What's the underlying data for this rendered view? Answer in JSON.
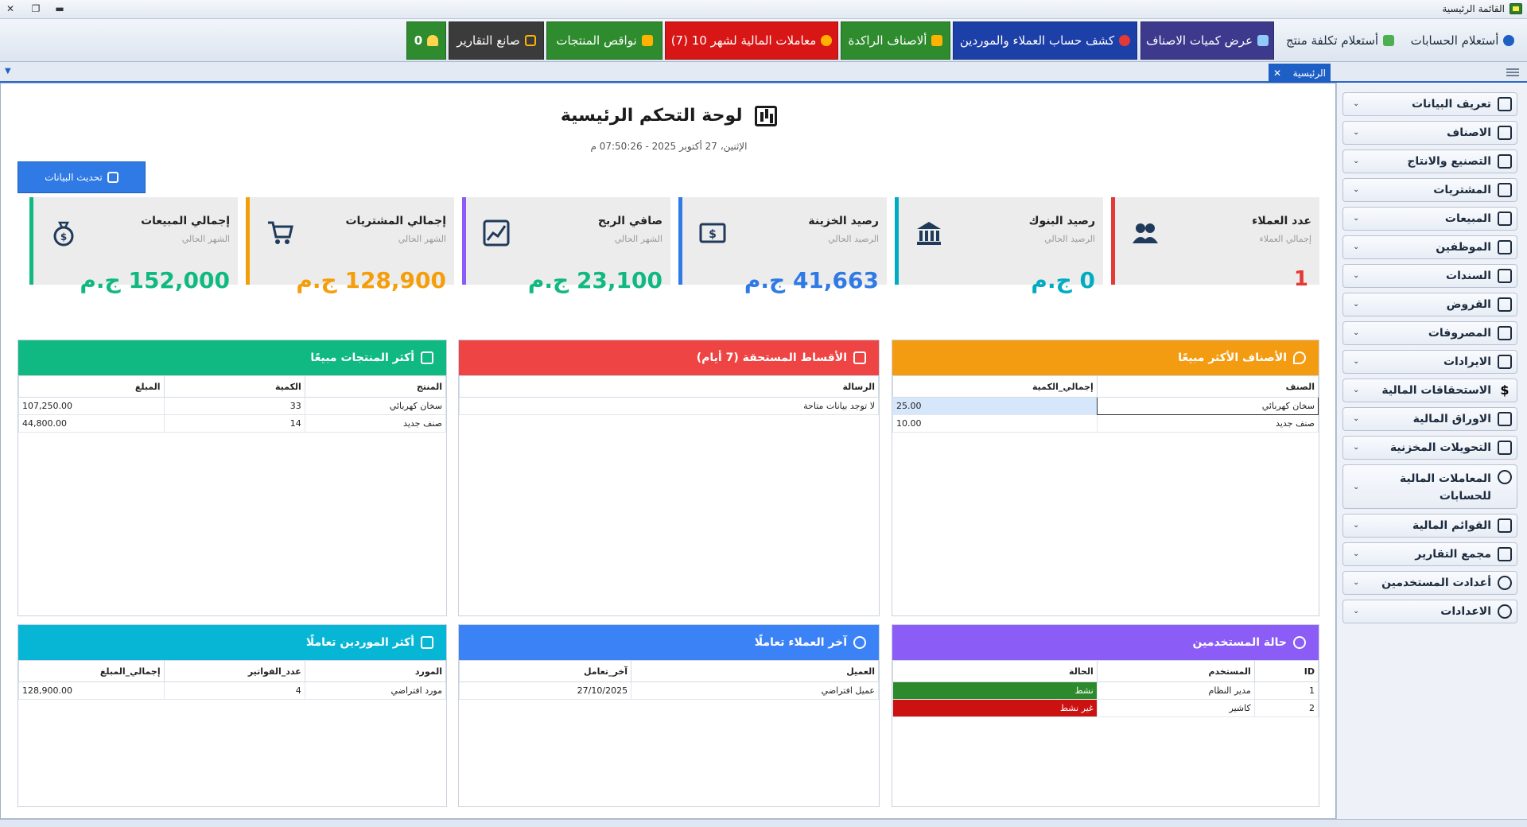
{
  "window": {
    "title": "القائمة الرئيسية"
  },
  "toolbar": {
    "buttons": [
      {
        "label": "أستعلام الحسابات"
      },
      {
        "label": "أستعلام تكلفة منتج"
      },
      {
        "label": "عرض كميات الاصناف"
      },
      {
        "label": "كشف حساب العملاء والموردين"
      },
      {
        "label": "ألاصناف الراكدة"
      },
      {
        "label": "معاملات المالية لشهر 10  (7)"
      },
      {
        "label": "نواقص المنتجات"
      },
      {
        "label": "صانع التقارير"
      },
      {
        "label": "0"
      }
    ]
  },
  "tabs": {
    "home": "الرئيسية",
    "close": "✕"
  },
  "sidebar": {
    "items": [
      {
        "label": "تعريف البيانات",
        "icon": "database-icon"
      },
      {
        "label": "الاصناف",
        "icon": "box-icon"
      },
      {
        "label": "التصنيع والانتاج",
        "icon": "factory-icon"
      },
      {
        "label": "المشتريات",
        "icon": "cart-icon"
      },
      {
        "label": "المبيعات",
        "icon": "invoice-icon"
      },
      {
        "label": "الموظفين",
        "icon": "badge-icon"
      },
      {
        "label": "السندات",
        "icon": "receipt-icon"
      },
      {
        "label": "القروض",
        "icon": "loan-icon"
      },
      {
        "label": "المصروفات",
        "icon": "expense-icon"
      },
      {
        "label": "الايرادات",
        "icon": "income-icon"
      },
      {
        "label": "الاستحقاقات المالية",
        "icon": "dollar-icon"
      },
      {
        "label": "الاوراق المالية",
        "icon": "securities-icon"
      },
      {
        "label": "التحويلات المخزنية",
        "icon": "transfer-icon"
      },
      {
        "label": "المعاملات المالية للحسابات",
        "icon": "gear-icon"
      },
      {
        "label": "القوائم المالية",
        "icon": "briefcase-icon"
      },
      {
        "label": "مجمع التقارير",
        "icon": "report-icon"
      },
      {
        "label": "أعدادت المستخدمين",
        "icon": "users-icon"
      },
      {
        "label": "الاعدادات",
        "icon": "settings-icon"
      }
    ]
  },
  "dashboard": {
    "title": "لوحة التحكم الرئيسية",
    "datetime": "الإثنين، 27 أكتوبر 2025 - 07:50:26 م",
    "refresh_label": "تحديث البيانات"
  },
  "cards": [
    {
      "title": "عدد العملاء",
      "sub": "إجمالي العملاء",
      "value": "1",
      "color": "#e53935"
    },
    {
      "title": "رصيد البنوك",
      "sub": "الرصيد الحالي",
      "value": "0 ج.م",
      "color": "#00acc1"
    },
    {
      "title": "رصيد الخزينة",
      "sub": "الرصيد الحالي",
      "value": "41,663 ج.م",
      "color": "#2f7ae5"
    },
    {
      "title": "صافي الربح",
      "sub": "الشهر الحالي",
      "value": "23,100 ج.م",
      "color": "#10b981"
    },
    {
      "title": "إجمالي المشتريات",
      "sub": "الشهر الحالي",
      "value": "128,900 ج.م",
      "color": "#f59e0b"
    },
    {
      "title": "إجمالي المبيعات",
      "sub": "الشهر الحالي",
      "value": "152,000 ج.م",
      "color": "#10b981"
    }
  ],
  "panels": {
    "top_categories": {
      "title": "الأصناف الأكثر مبيعًا",
      "columns": [
        "الصنف",
        "إجمالي_الكمية"
      ],
      "rows": [
        [
          "سخان كهربائي",
          "25.00"
        ],
        [
          "صنف جديد",
          "10.00"
        ]
      ]
    },
    "installments": {
      "title": "الأقساط المستحقة (7 أيام)",
      "columns": [
        "الرسالة"
      ],
      "rows": [
        [
          "لا توجد بيانات متاحة"
        ]
      ]
    },
    "top_products": {
      "title": "أكثر المنتجات مبيعًا",
      "columns": [
        "المنتج",
        "الكمية",
        "المبلغ"
      ],
      "rows": [
        [
          "سخان كهربائي",
          "33",
          "107,250.00"
        ],
        [
          "صنف جديد",
          "14",
          "44,800.00"
        ]
      ]
    },
    "users_status": {
      "title": "حالة المستخدمين",
      "columns": [
        "ID",
        "المستخدم",
        "الحالة"
      ],
      "rows": [
        [
          "1",
          "مدير النظام",
          "نشط"
        ],
        [
          "2",
          "كاشير",
          "غير نشط"
        ]
      ]
    },
    "recent_customers": {
      "title": "آخر العملاء تعاملًا",
      "columns": [
        "العميل",
        "آخر_تعامل"
      ],
      "rows": [
        [
          "عميل افتراضي",
          "27/10/2025"
        ]
      ]
    },
    "top_suppliers": {
      "title": "أكثر الموردين تعاملًا",
      "columns": [
        "المورد",
        "عدد_الفواتير",
        "إجمالي_المبلغ"
      ],
      "rows": [
        [
          "مورد افتراضي",
          "4",
          "128,900.00"
        ]
      ]
    }
  }
}
